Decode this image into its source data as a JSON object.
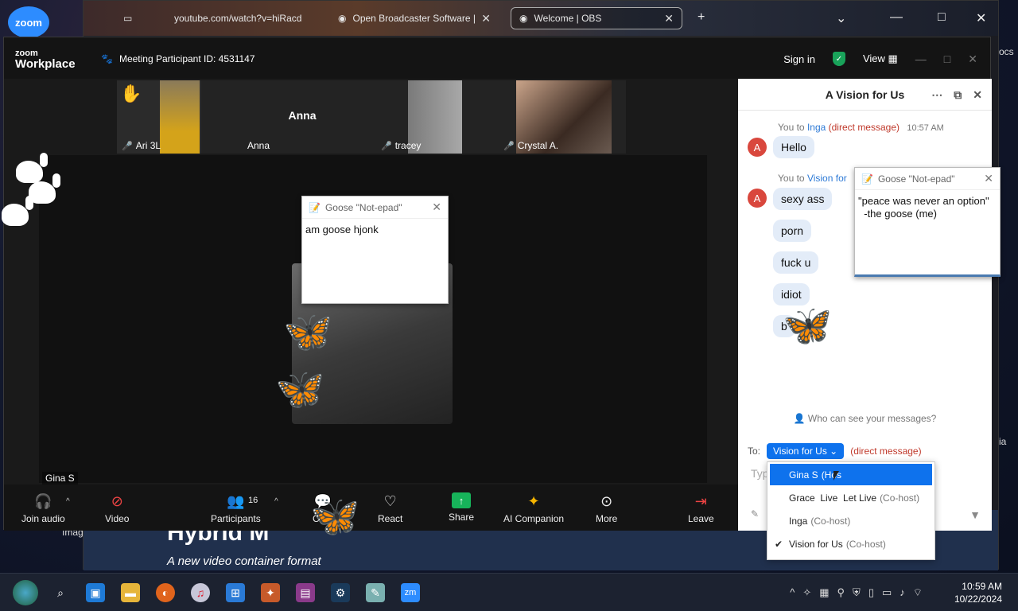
{
  "desktop": {
    "zoom_icon_label": "zoom",
    "right_label_1": "ocs",
    "right_label_2": "ia",
    "left_label": "Imag"
  },
  "browser": {
    "tabs": [
      {
        "label": "youtube.com/watch?v=hiRacd"
      },
      {
        "label": "Open Broadcaster Software | OB"
      },
      {
        "label": "Welcome | OBS"
      }
    ],
    "new_tab": "+",
    "page_title": "Hybrid M",
    "page_subtitle": "A new video container format"
  },
  "zoom": {
    "brand_line1": "zoom",
    "brand_line2": "Workplace",
    "meeting_id": "Meeting Participant ID: 4531147",
    "sign_in": "Sign in",
    "view": "View"
  },
  "strip": {
    "tiles": [
      {
        "name": "Ari 3L"
      },
      {
        "name": "Anna",
        "center_name": "Anna"
      },
      {
        "name": "tracey"
      },
      {
        "name": "Crystal A."
      }
    ]
  },
  "stage": {
    "active_speaker": "Gina S"
  },
  "goose_popup_1": {
    "title": "Goose \"Not-epad\"",
    "text": "am goose hjonk"
  },
  "goose_popup_2": {
    "title": "Goose \"Not-epad\"",
    "text": "\"peace was never an option\"\n  -the goose (me)"
  },
  "toolbar": {
    "join_audio": "Join audio",
    "video": "Video",
    "participants": "Participants",
    "participants_count": "16",
    "chat": "Chat",
    "react": "React",
    "share": "Share",
    "ai_companion": "AI Companion",
    "more": "More",
    "leave": "Leave"
  },
  "chat": {
    "title": "A Vision for Us",
    "msg_group_1": {
      "you_to": "You to",
      "recipient": "Inga",
      "dm": "(direct message)",
      "time": "10:57 AM"
    },
    "msg_group_2": {
      "you_to": "You to",
      "recipient": "Vision for"
    },
    "avatar_letter": "A",
    "messages": [
      "Hello",
      "sexy ass",
      "porn",
      "fuck u",
      "idiot",
      "b"
    ],
    "who_can_see": "Who can see your messages?",
    "to_label": "To:",
    "to_value": "Vision for Us",
    "to_dm": "(direct message)",
    "type_placeholder": "Typ"
  },
  "dropdown": {
    "items": [
      {
        "name": "Gina S",
        "role": "(Hos"
      },
      {
        "name": "Grace  Live  Let Live",
        "role": "(Co-host)"
      },
      {
        "name": "Inga",
        "role": "(Co-host)"
      },
      {
        "name": "Vision for Us",
        "role": "(Co-host)"
      }
    ]
  },
  "taskbar": {
    "time": "10:59 AM",
    "date": "10/22/2024",
    "zoom_label": "zm"
  }
}
